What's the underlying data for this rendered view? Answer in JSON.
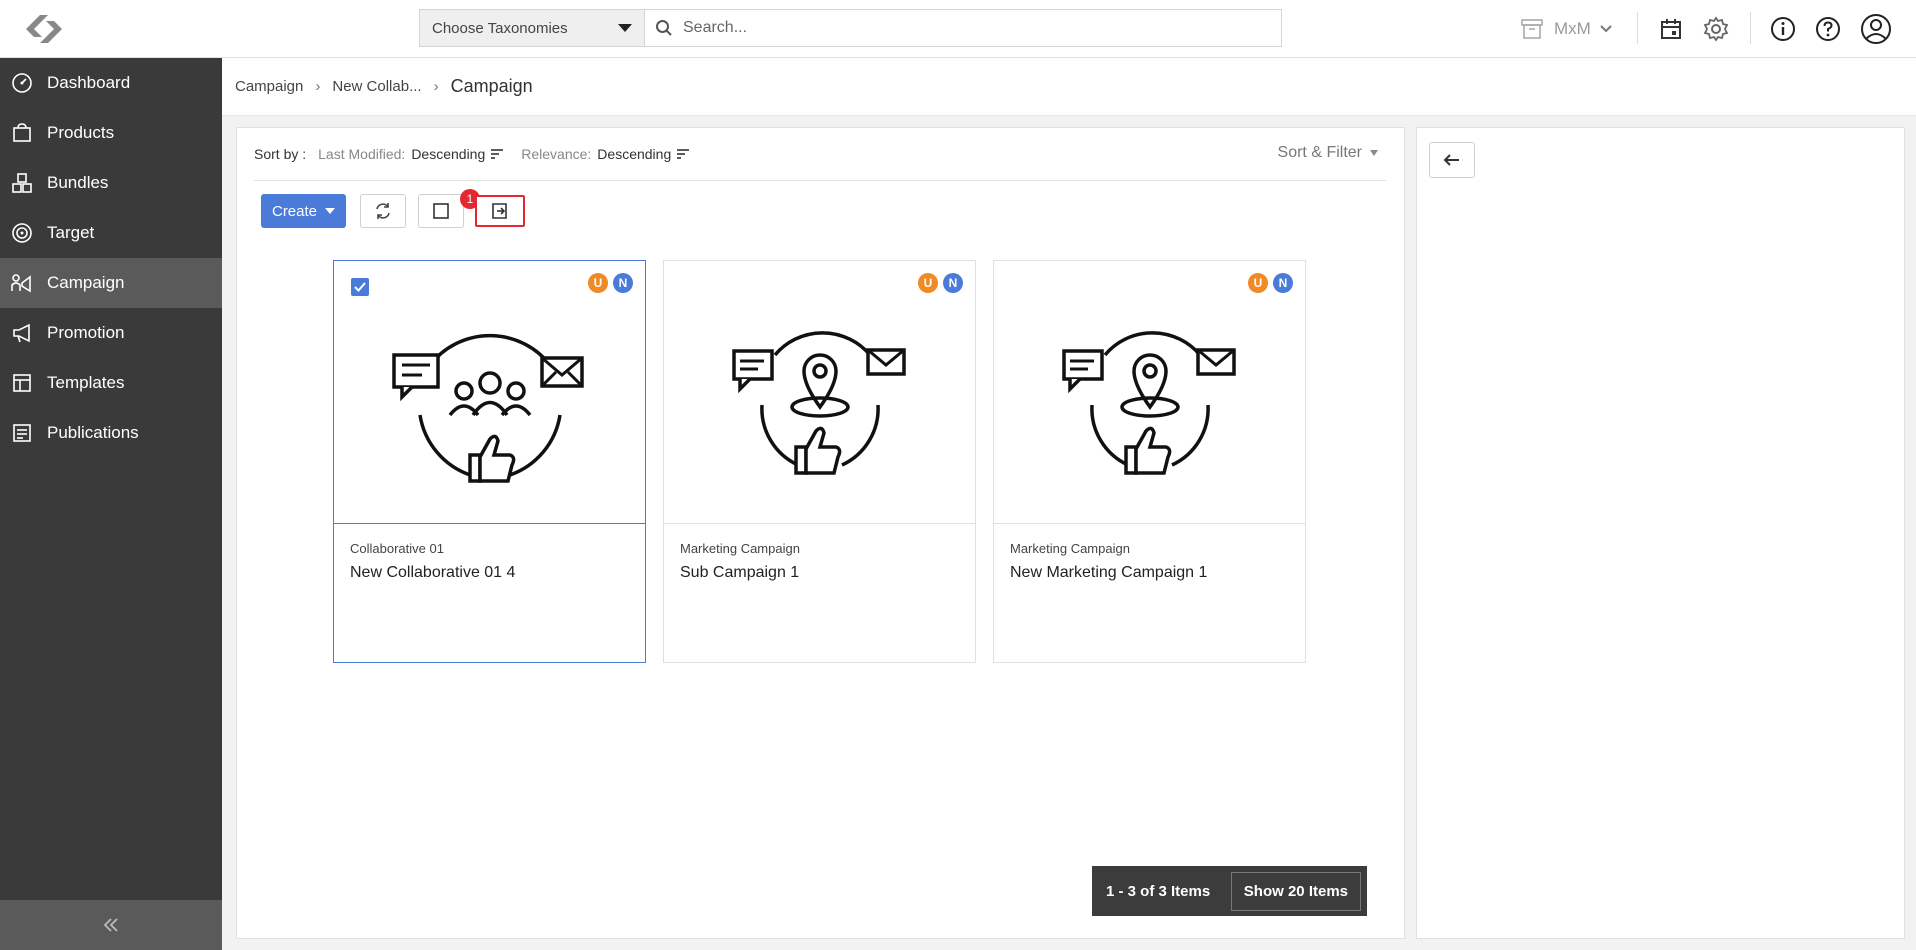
{
  "topbar": {
    "taxonomy_select": "Choose Taxonomies",
    "search_placeholder": "Search...",
    "org_label": "MxM"
  },
  "sidebar": {
    "items": [
      {
        "label": "Dashboard",
        "icon": "dashboard-icon"
      },
      {
        "label": "Products",
        "icon": "products-icon"
      },
      {
        "label": "Bundles",
        "icon": "bundles-icon"
      },
      {
        "label": "Target",
        "icon": "target-icon"
      },
      {
        "label": "Campaign",
        "icon": "campaign-icon",
        "active": true
      },
      {
        "label": "Promotion",
        "icon": "megaphone-icon"
      },
      {
        "label": "Templates",
        "icon": "templates-icon"
      },
      {
        "label": "Publications",
        "icon": "publications-icon"
      }
    ]
  },
  "breadcrumb": {
    "items": [
      "Campaign",
      "New Collab..."
    ],
    "current": "Campaign"
  },
  "sortbar": {
    "label": "Sort by :",
    "sorts": [
      {
        "key": "Last Modified:",
        "value": "Descending"
      },
      {
        "key": "Relevance:",
        "value": "Descending"
      }
    ],
    "filter_label": "Sort & Filter"
  },
  "toolbar": {
    "create_label": "Create",
    "selected_badge": "1"
  },
  "cards": [
    {
      "type": "Collaborative 01",
      "name": "New Collaborative 01 4",
      "selected": true,
      "pill_u": "U",
      "pill_n": "N"
    },
    {
      "type": "Marketing Campaign",
      "name": "Sub Campaign 1",
      "selected": false,
      "pill_u": "U",
      "pill_n": "N"
    },
    {
      "type": "Marketing Campaign",
      "name": "New Marketing Campaign 1",
      "selected": false,
      "pill_u": "U",
      "pill_n": "N"
    }
  ],
  "pager": {
    "count_label": "1 - 3 of 3 Items",
    "show_label": "Show 20 Items"
  },
  "colors": {
    "accent": "#4a7bd9",
    "sidebar_bg": "#3a3a3a",
    "badge_red": "#e5282f",
    "pill_orange": "#f08a24"
  }
}
